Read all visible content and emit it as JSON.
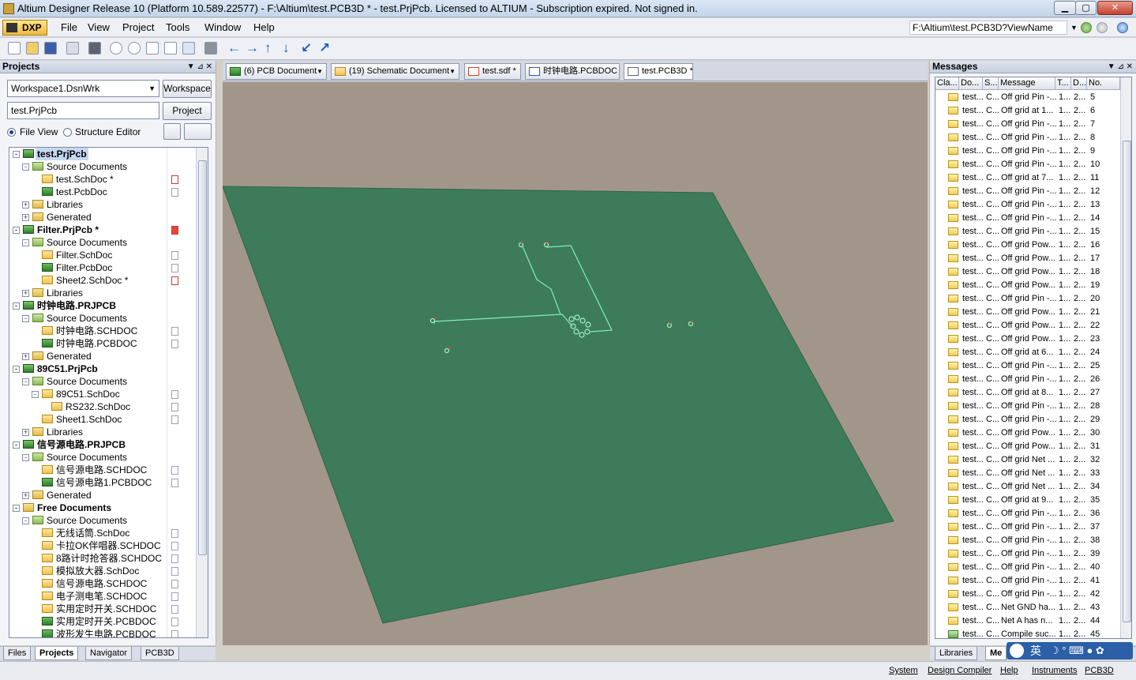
{
  "window": {
    "title": "Altium Designer Release 10 (Platform 10.589.22577) - F:\\Altium\\test.PCB3D * - test.PrjPcb. Licensed to ALTIUM - Subscription expired. Not signed in.",
    "min": "▁",
    "max": "▢",
    "close": "✕"
  },
  "menubar": {
    "dxp": "DXP",
    "items": [
      "File",
      "View",
      "Project",
      "Tools",
      "Window",
      "Help"
    ],
    "address": "F:\\Altium\\test.PCB3D?ViewName"
  },
  "projects_panel": {
    "title": "Projects",
    "workspace_value": "Workspace1.DsnWrk",
    "workspace_button": "Workspace",
    "project_value": "test.PrjPcb",
    "project_button": "Project",
    "view_file": "File View",
    "view_structure": "Structure Editor",
    "tree": [
      {
        "label": "test.PrjPcb",
        "level": 0,
        "kind": "prj",
        "bold": true,
        "exp": "-",
        "selected": true
      },
      {
        "label": "Source Documents",
        "level": 1,
        "kind": "srcfolder",
        "exp": "-"
      },
      {
        "label": "test.SchDoc *",
        "level": 2,
        "kind": "sch",
        "doc": "mod"
      },
      {
        "label": "test.PcbDoc",
        "level": 2,
        "kind": "pcb",
        "doc": "plain"
      },
      {
        "label": "Libraries",
        "level": 1,
        "kind": "folder",
        "exp": "+"
      },
      {
        "label": "Generated",
        "level": 1,
        "kind": "folder",
        "exp": "+"
      },
      {
        "label": "Filter.PrjPcb *",
        "level": 0,
        "kind": "prj",
        "bold": true,
        "exp": "-",
        "doc": "modfill"
      },
      {
        "label": "Source Documents",
        "level": 1,
        "kind": "srcfolder",
        "exp": "-"
      },
      {
        "label": "Filter.SchDoc",
        "level": 2,
        "kind": "sch",
        "doc": "plain"
      },
      {
        "label": "Filter.PcbDoc",
        "level": 2,
        "kind": "pcb",
        "doc": "plain"
      },
      {
        "label": "Sheet2.SchDoc *",
        "level": 2,
        "kind": "sch",
        "doc": "mod"
      },
      {
        "label": "Libraries",
        "level": 1,
        "kind": "folder",
        "exp": "+"
      },
      {
        "label": "时钟电路.PRJPCB",
        "level": 0,
        "kind": "prj",
        "bold": true,
        "exp": "-"
      },
      {
        "label": "Source Documents",
        "level": 1,
        "kind": "srcfolder",
        "exp": "-"
      },
      {
        "label": "时钟电路.SCHDOC",
        "level": 2,
        "kind": "sch",
        "doc": "plain"
      },
      {
        "label": "时钟电路.PCBDOC",
        "level": 2,
        "kind": "pcb",
        "doc": "plain"
      },
      {
        "label": "Generated",
        "level": 1,
        "kind": "folder",
        "exp": "+"
      },
      {
        "label": "89C51.PrjPcb",
        "level": 0,
        "kind": "prj",
        "bold": true,
        "exp": "-"
      },
      {
        "label": "Source Documents",
        "level": 1,
        "kind": "srcfolder",
        "exp": "-"
      },
      {
        "label": "89C51.SchDoc",
        "level": 2,
        "kind": "sch",
        "exp": "-",
        "doc": "plain"
      },
      {
        "label": "RS232.SchDoc",
        "level": 3,
        "kind": "sch",
        "doc": "plain"
      },
      {
        "label": "Sheet1.SchDoc",
        "level": 2,
        "kind": "sch",
        "doc": "plain"
      },
      {
        "label": "Libraries",
        "level": 1,
        "kind": "folder",
        "exp": "+"
      },
      {
        "label": "信号源电路.PRJPCB",
        "level": 0,
        "kind": "prj",
        "bold": true,
        "exp": "-"
      },
      {
        "label": "Source Documents",
        "level": 1,
        "kind": "srcfolder",
        "exp": "-"
      },
      {
        "label": "信号源电路.SCHDOC",
        "level": 2,
        "kind": "sch",
        "doc": "plain"
      },
      {
        "label": "信号源电路1.PCBDOC",
        "level": 2,
        "kind": "pcb",
        "doc": "plain"
      },
      {
        "label": "Generated",
        "level": 1,
        "kind": "folder",
        "exp": "+"
      },
      {
        "label": "Free Documents",
        "level": 0,
        "kind": "folder",
        "bold": true,
        "exp": "-"
      },
      {
        "label": "Source Documents",
        "level": 1,
        "kind": "srcfolder",
        "exp": "-"
      },
      {
        "label": "无线话筒.SchDoc",
        "level": 2,
        "kind": "sch",
        "doc": "plain"
      },
      {
        "label": "卡拉OK伴唱器.SCHDOC",
        "level": 2,
        "kind": "sch",
        "doc": "plain"
      },
      {
        "label": "8路计时抢答器.SCHDOC",
        "level": 2,
        "kind": "sch",
        "doc": "plain"
      },
      {
        "label": "模拟放大器.SchDoc",
        "level": 2,
        "kind": "sch",
        "doc": "plain"
      },
      {
        "label": "信号源电路.SCHDOC",
        "level": 2,
        "kind": "sch",
        "doc": "plain"
      },
      {
        "label": "电子测电笔.SCHDOC",
        "level": 2,
        "kind": "sch",
        "doc": "plain"
      },
      {
        "label": "实用定时开关.SCHDOC",
        "level": 2,
        "kind": "sch",
        "doc": "plain"
      },
      {
        "label": "实用定时开关.PCBDOC",
        "level": 2,
        "kind": "pcb",
        "doc": "plain"
      },
      {
        "label": "波形发生电路.PCBDOC",
        "level": 2,
        "kind": "pcb",
        "doc": "plain"
      }
    ],
    "bottom_tabs": [
      "Files",
      "Projects",
      "Navigator",
      "PCB3D"
    ]
  },
  "doc_tabs": [
    {
      "label": "(6) PCB Document",
      "kind": "pcb",
      "dropdown": true
    },
    {
      "label": "(19) Schematic Document",
      "kind": "sch",
      "dropdown": true
    },
    {
      "label": "test.sdf *",
      "kind": "sdf"
    },
    {
      "label": "时钟电路.PCBDOC",
      "kind": "pcb"
    },
    {
      "label": "test.PCB3D *",
      "kind": "pcb3d",
      "active": true
    }
  ],
  "messages_panel": {
    "title": "Messages",
    "columns": [
      "Cla...",
      "Do...",
      "S...",
      "Message",
      "T...",
      "D...",
      "No."
    ],
    "rows": [
      {
        "doc": "test...",
        "src": "C...",
        "msg": "Off grid Pin -...",
        "t": "1...",
        "d": "2...",
        "no": "5"
      },
      {
        "doc": "test...",
        "src": "C...",
        "msg": "Off grid  at 1...",
        "t": "1...",
        "d": "2...",
        "no": "6"
      },
      {
        "doc": "test...",
        "src": "C...",
        "msg": "Off grid Pin -...",
        "t": "1...",
        "d": "2...",
        "no": "7"
      },
      {
        "doc": "test...",
        "src": "C...",
        "msg": "Off grid Pin -...",
        "t": "1...",
        "d": "2...",
        "no": "8"
      },
      {
        "doc": "test...",
        "src": "C...",
        "msg": "Off grid Pin -...",
        "t": "1...",
        "d": "2...",
        "no": "9"
      },
      {
        "doc": "test...",
        "src": "C...",
        "msg": "Off grid Pin -...",
        "t": "1...",
        "d": "2...",
        "no": "10"
      },
      {
        "doc": "test...",
        "src": "C...",
        "msg": "Off grid  at 7...",
        "t": "1...",
        "d": "2...",
        "no": "11"
      },
      {
        "doc": "test...",
        "src": "C...",
        "msg": "Off grid Pin -...",
        "t": "1...",
        "d": "2...",
        "no": "12"
      },
      {
        "doc": "test...",
        "src": "C...",
        "msg": "Off grid Pin -...",
        "t": "1...",
        "d": "2...",
        "no": "13"
      },
      {
        "doc": "test...",
        "src": "C...",
        "msg": "Off grid Pin -...",
        "t": "1...",
        "d": "2...",
        "no": "14"
      },
      {
        "doc": "test...",
        "src": "C...",
        "msg": "Off grid Pin -...",
        "t": "1...",
        "d": "2...",
        "no": "15"
      },
      {
        "doc": "test...",
        "src": "C...",
        "msg": "Off grid Pow...",
        "t": "1...",
        "d": "2...",
        "no": "16"
      },
      {
        "doc": "test...",
        "src": "C...",
        "msg": "Off grid Pow...",
        "t": "1...",
        "d": "2...",
        "no": "17"
      },
      {
        "doc": "test...",
        "src": "C...",
        "msg": "Off grid Pow...",
        "t": "1...",
        "d": "2...",
        "no": "18"
      },
      {
        "doc": "test...",
        "src": "C...",
        "msg": "Off grid Pow...",
        "t": "1...",
        "d": "2...",
        "no": "19"
      },
      {
        "doc": "test...",
        "src": "C...",
        "msg": "Off grid Pin -...",
        "t": "1...",
        "d": "2...",
        "no": "20"
      },
      {
        "doc": "test...",
        "src": "C...",
        "msg": "Off grid Pow...",
        "t": "1...",
        "d": "2...",
        "no": "21"
      },
      {
        "doc": "test...",
        "src": "C...",
        "msg": "Off grid Pow...",
        "t": "1...",
        "d": "2...",
        "no": "22"
      },
      {
        "doc": "test...",
        "src": "C...",
        "msg": "Off grid Pow...",
        "t": "1...",
        "d": "2...",
        "no": "23"
      },
      {
        "doc": "test...",
        "src": "C...",
        "msg": "Off grid  at 6...",
        "t": "1...",
        "d": "2...",
        "no": "24"
      },
      {
        "doc": "test...",
        "src": "C...",
        "msg": "Off grid Pin -...",
        "t": "1...",
        "d": "2...",
        "no": "25"
      },
      {
        "doc": "test...",
        "src": "C...",
        "msg": "Off grid Pin -...",
        "t": "1...",
        "d": "2...",
        "no": "26"
      },
      {
        "doc": "test...",
        "src": "C...",
        "msg": "Off grid  at 8...",
        "t": "1...",
        "d": "2...",
        "no": "27"
      },
      {
        "doc": "test...",
        "src": "C...",
        "msg": "Off grid Pin -...",
        "t": "1...",
        "d": "2...",
        "no": "28"
      },
      {
        "doc": "test...",
        "src": "C...",
        "msg": "Off grid Pin -...",
        "t": "1...",
        "d": "2...",
        "no": "29"
      },
      {
        "doc": "test...",
        "src": "C...",
        "msg": "Off grid Pow...",
        "t": "1...",
        "d": "2...",
        "no": "30"
      },
      {
        "doc": "test...",
        "src": "C...",
        "msg": "Off grid Pow...",
        "t": "1...",
        "d": "2...",
        "no": "31"
      },
      {
        "doc": "test...",
        "src": "C...",
        "msg": "Off grid Net ...",
        "t": "1...",
        "d": "2...",
        "no": "32"
      },
      {
        "doc": "test...",
        "src": "C...",
        "msg": "Off grid Net ...",
        "t": "1...",
        "d": "2...",
        "no": "33"
      },
      {
        "doc": "test...",
        "src": "C...",
        "msg": "Off grid Net ...",
        "t": "1...",
        "d": "2...",
        "no": "34"
      },
      {
        "doc": "test...",
        "src": "C...",
        "msg": "Off grid  at 9...",
        "t": "1...",
        "d": "2...",
        "no": "35"
      },
      {
        "doc": "test...",
        "src": "C...",
        "msg": "Off grid Pin -...",
        "t": "1...",
        "d": "2...",
        "no": "36"
      },
      {
        "doc": "test...",
        "src": "C...",
        "msg": "Off grid Pin -...",
        "t": "1...",
        "d": "2...",
        "no": "37"
      },
      {
        "doc": "test...",
        "src": "C...",
        "msg": "Off grid Pin -...",
        "t": "1...",
        "d": "2...",
        "no": "38"
      },
      {
        "doc": "test...",
        "src": "C...",
        "msg": "Off grid Pin -...",
        "t": "1...",
        "d": "2...",
        "no": "39"
      },
      {
        "doc": "test...",
        "src": "C...",
        "msg": "Off grid Pin -...",
        "t": "1...",
        "d": "2...",
        "no": "40"
      },
      {
        "doc": "test...",
        "src": "C...",
        "msg": "Off grid Pin -...",
        "t": "1...",
        "d": "2...",
        "no": "41"
      },
      {
        "doc": "test...",
        "src": "C...",
        "msg": "Off grid Pin -...",
        "t": "1...",
        "d": "2...",
        "no": "42"
      },
      {
        "doc": "test...",
        "src": "C...",
        "msg": "Net GND ha...",
        "t": "1...",
        "d": "2...",
        "no": "43"
      },
      {
        "doc": "test...",
        "src": "C...",
        "msg": "Net A has n...",
        "t": "1...",
        "d": "2...",
        "no": "44"
      },
      {
        "doc": "test...",
        "src": "C...",
        "msg": "Compile suc...",
        "t": "1...",
        "d": "2...",
        "no": "45",
        "ok": true
      }
    ],
    "bottom_tabs": [
      "Libraries",
      "Me"
    ]
  },
  "statusbar": {
    "items": [
      "System",
      "Design Compiler",
      "Help",
      "Instruments",
      "PCB3D"
    ]
  },
  "ime": {
    "label": "英"
  },
  "colors": {
    "board": "#3d7b5a",
    "viewport_bg": "#a2968a",
    "trace": "#7ff0b8"
  }
}
